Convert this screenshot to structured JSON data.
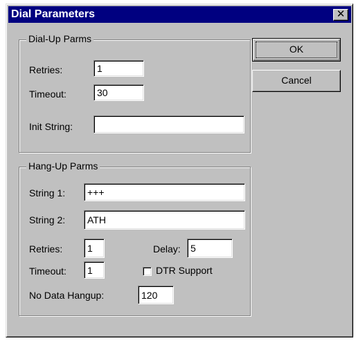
{
  "window": {
    "title": "Dial Parameters",
    "close_glyph": "✕"
  },
  "buttons": {
    "ok": "OK",
    "cancel": "Cancel"
  },
  "dialup": {
    "legend": "Dial-Up Parms",
    "retries_label": "Retries:",
    "retries_value": "1",
    "timeout_label": "Timeout:",
    "timeout_value": "30",
    "init_label": "Init String:",
    "init_value": ""
  },
  "hangup": {
    "legend": "Hang-Up Parms",
    "string1_label": "String 1:",
    "string1_value": "+++",
    "string2_label": "String 2:",
    "string2_value": "ATH",
    "retries_label": "Retries:",
    "retries_value": "1",
    "delay_label": "Delay:",
    "delay_value": "5",
    "timeout_label": "Timeout:",
    "timeout_value": "1",
    "dtr_label": "DTR Support",
    "dtr_checked": false,
    "nodata_label": "No Data Hangup:",
    "nodata_value": "120"
  }
}
